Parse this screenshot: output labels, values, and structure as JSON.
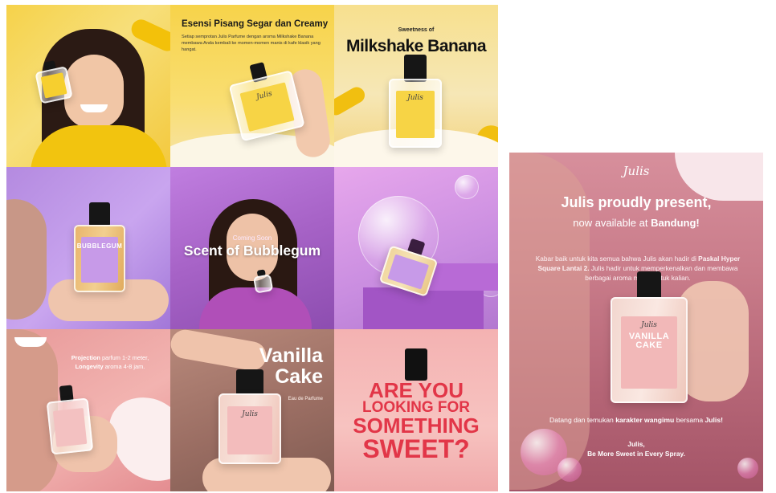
{
  "colors": {
    "yellow": "#f6d24a",
    "purple": "#b48ae0",
    "pink": "#f2b3b0",
    "accent_red": "#e23648",
    "poster_bg": "#c97c8a"
  },
  "tiles": {
    "t2": {
      "title": "Esensi Pisang Segar dan Creamy",
      "body": "Setiap semprotan Julis Parfume dengan aroma Milkshake Banana membawa Anda kembali ke momen-momen manis di kafe klasik yang hangat."
    },
    "t3": {
      "sub": "Sweetness of",
      "title": "Milkshake Banana"
    },
    "t4": {
      "label": "BUBBLEGUM"
    },
    "t5": {
      "coming": "Coming Soon",
      "title": "Scent of Bubblegum"
    },
    "t7": {
      "projection_label": "Projection",
      "projection_text": "parfum 1-2 meter,",
      "longevity_label": "Longevity",
      "longevity_text": "aroma 4-8 jam."
    },
    "t8": {
      "title_line1": "Vanilla",
      "title_line2": "Cake",
      "sub": "Eau de Parfume"
    },
    "t9": {
      "line1": "ARE YOU",
      "line2": "LOOKING FOR",
      "line3": "SOMETHING",
      "line4": "SWEET?"
    },
    "bottle_brand": "Julis",
    "bottle_label_vanilla": "VANILLA CAKE"
  },
  "poster": {
    "logo": "Julis",
    "headline": "Julis proudly present,",
    "sub_prefix": "now available at",
    "sub_city": "Bandung!",
    "para_1": "Kabar baik untuk kita semua bahwa Julis akan hadir di",
    "para_place": "Paskal Hyper Square Lantai 2.",
    "para_2": "Julis hadir untuk memperkenalkan dan membawa berbagai aroma manis untuk kalian.",
    "cta_1": "Datang dan temukan",
    "cta_b1": "karakter wangimu",
    "cta_2": "bersama",
    "cta_b2": "Julis!",
    "sign_1": "Julis,",
    "sign_2": "Be More Sweet in Every Spray."
  }
}
